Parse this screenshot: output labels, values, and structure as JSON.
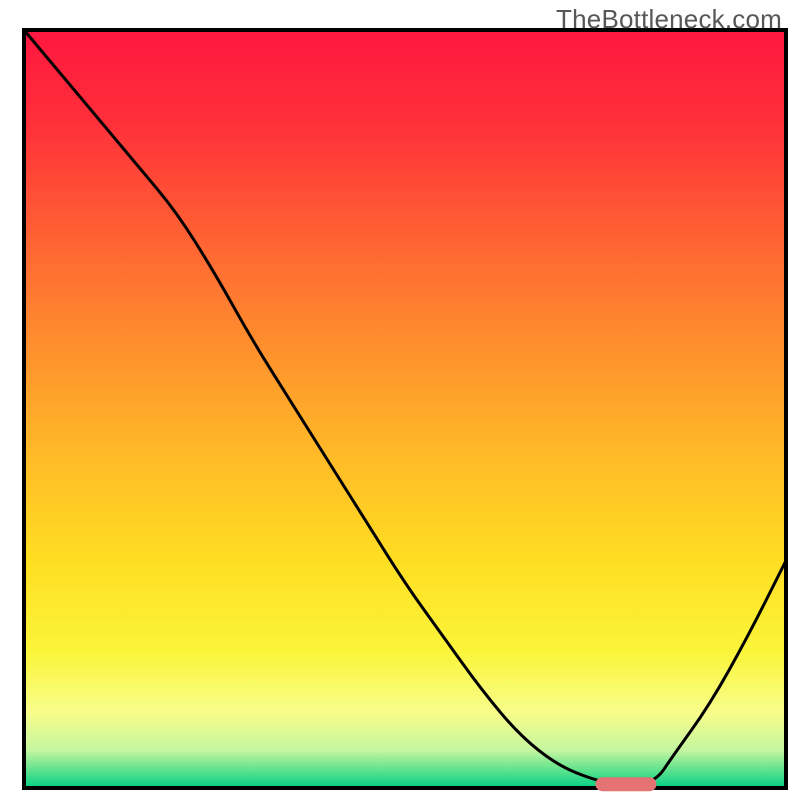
{
  "watermark": "TheBottleneck.com",
  "chart_data": {
    "type": "line",
    "title": "",
    "xlabel": "",
    "ylabel": "",
    "xlim": [
      0,
      100
    ],
    "ylim": [
      0,
      100
    ],
    "grid": false,
    "legend": false,
    "x": [
      0,
      5,
      10,
      15,
      20,
      25,
      30,
      35,
      40,
      45,
      50,
      55,
      60,
      65,
      70,
      75,
      78,
      80,
      83,
      85,
      90,
      95,
      100
    ],
    "values": [
      100,
      94,
      88,
      82,
      76,
      68,
      59,
      51,
      43,
      35,
      27,
      20,
      13,
      7,
      3,
      1,
      0.5,
      0.5,
      1,
      4,
      11,
      20,
      30
    ],
    "highlight_segment": {
      "x_start": 75,
      "x_end": 83,
      "y": 0.5
    },
    "gradient_stops": [
      {
        "offset": 0.0,
        "color": "#ff173f"
      },
      {
        "offset": 0.12,
        "color": "#ff2f3a"
      },
      {
        "offset": 0.25,
        "color": "#ff5a34"
      },
      {
        "offset": 0.4,
        "color": "#ff8a2e"
      },
      {
        "offset": 0.55,
        "color": "#ffb728"
      },
      {
        "offset": 0.7,
        "color": "#ffde22"
      },
      {
        "offset": 0.82,
        "color": "#fbf53a"
      },
      {
        "offset": 0.9,
        "color": "#f8fd8a"
      },
      {
        "offset": 0.95,
        "color": "#c5f6a0"
      },
      {
        "offset": 0.975,
        "color": "#64e38e"
      },
      {
        "offset": 1.0,
        "color": "#00d084"
      }
    ],
    "highlight_color": "#e57373",
    "border_color": "#000000",
    "curve_color": "#000000"
  }
}
